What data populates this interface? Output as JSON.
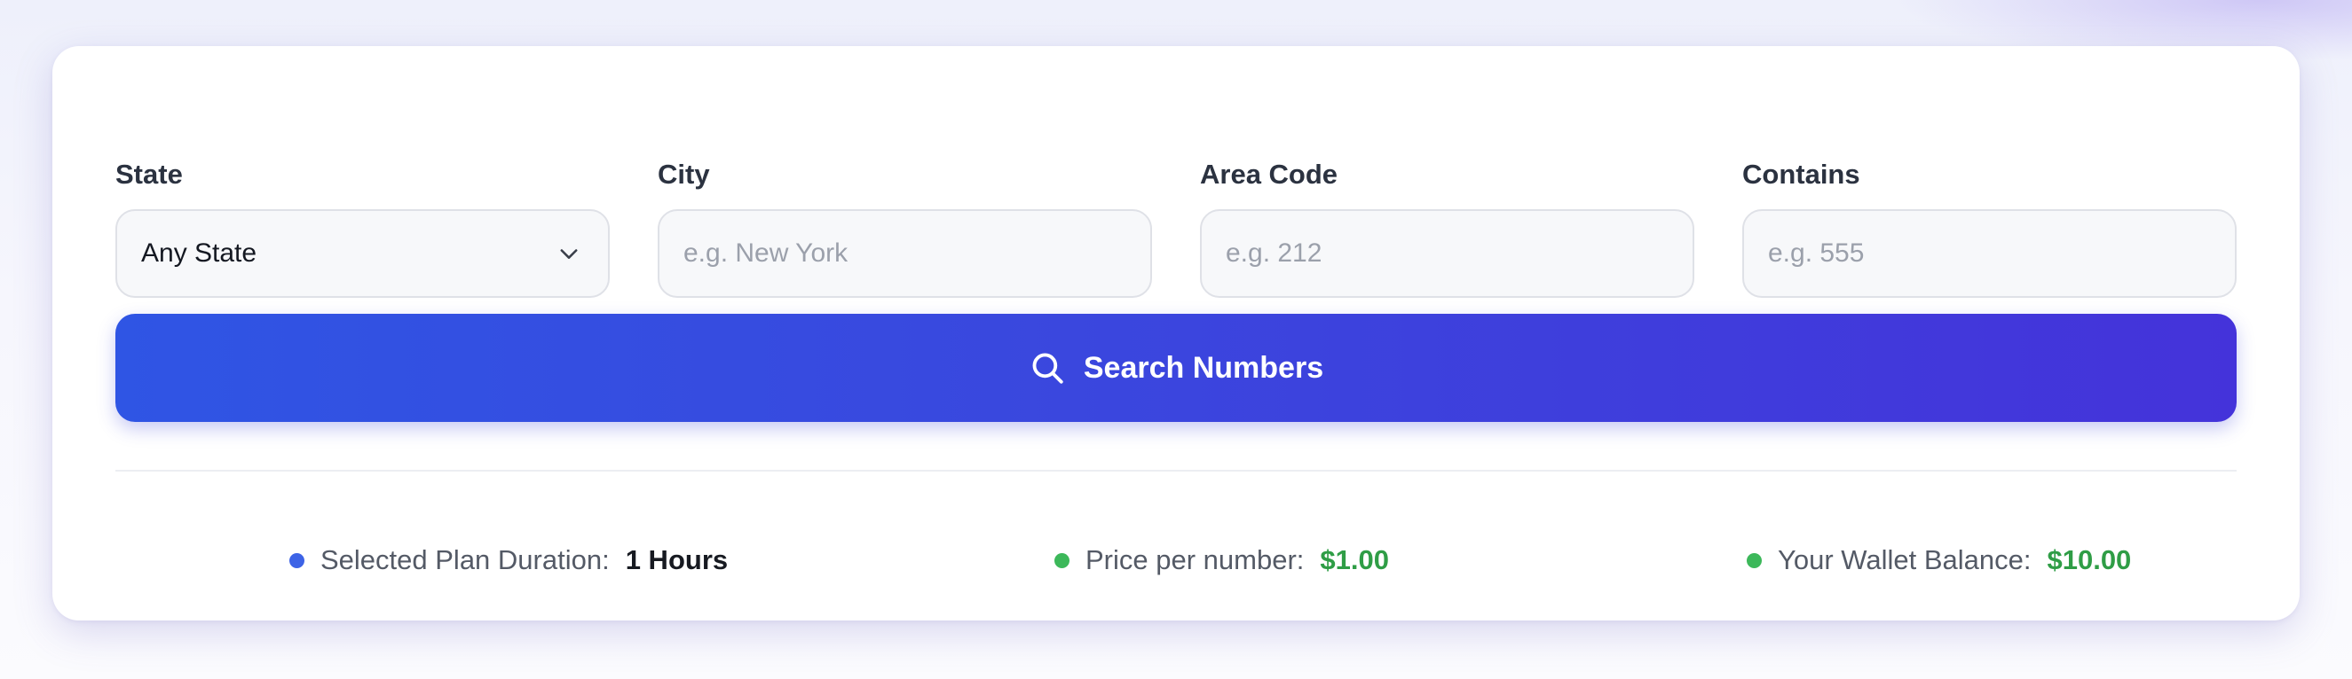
{
  "form": {
    "state": {
      "label": "State",
      "selected": "Any State"
    },
    "city": {
      "label": "City",
      "placeholder": "e.g. New York"
    },
    "area_code": {
      "label": "Area Code",
      "placeholder": "e.g. 212"
    },
    "contains": {
      "label": "Contains",
      "placeholder": "e.g. 555"
    }
  },
  "search_button": {
    "label": "Search Numbers",
    "icon": "search-icon"
  },
  "info": {
    "plan": {
      "label": "Selected Plan Duration:",
      "value": "1 Hours",
      "dot_color": "#3d63e6",
      "value_color": "#171a21"
    },
    "price": {
      "label": "Price per number:",
      "value": "$1.00",
      "dot_color": "#3cb85a",
      "value_color": "#2f9d46"
    },
    "wallet": {
      "label": "Your Wallet Balance:",
      "value": "$10.00",
      "dot_color": "#3cb85a",
      "value_color": "#2f9d46"
    }
  },
  "colors": {
    "accent_start": "#2f55e4",
    "accent_end": "#4433da",
    "label_text": "#2b3240",
    "muted_text": "#545a66"
  }
}
